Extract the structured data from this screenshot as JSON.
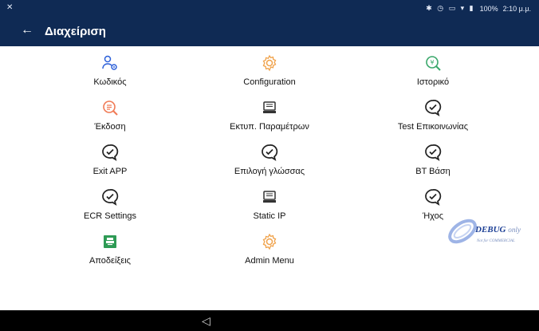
{
  "status_bar": {
    "left_icon": "notification-icon",
    "battery": "100%",
    "time": "2:10 μ.μ.",
    "icons": [
      "bluetooth-icon",
      "alarm-icon",
      "cast-icon",
      "wifi-icon",
      "signal-icon",
      "battery-icon"
    ]
  },
  "app_bar": {
    "title": "Διαχείριση"
  },
  "menu": [
    {
      "label": "Κωδικός",
      "icon": "user-settings-icon",
      "color": "#2b5fd9"
    },
    {
      "label": "Configuration",
      "icon": "gear-icon",
      "color": "#f0a24a"
    },
    {
      "label": "Ιστορικό",
      "icon": "coin-search-icon",
      "color": "#3aa86b"
    },
    {
      "label": "Έκδοση",
      "icon": "list-search-icon",
      "color": "#f07a55"
    },
    {
      "label": "Εκτυπ. Παραμέτρων",
      "icon": "printer-icon",
      "color": "#333333"
    },
    {
      "label": "Test Επικοινωνίας",
      "icon": "message-icon",
      "color": "#222222"
    },
    {
      "label": "Exit APP",
      "icon": "message-icon",
      "color": "#222222"
    },
    {
      "label": "Επιλογή γλώσσας",
      "icon": "message-icon",
      "color": "#222222"
    },
    {
      "label": "BT Βάση",
      "icon": "message-icon",
      "color": "#222222"
    },
    {
      "label": "ECR Settings",
      "icon": "message-icon",
      "color": "#222222"
    },
    {
      "label": "Static IP",
      "icon": "printer-icon",
      "color": "#333333"
    },
    {
      "label": "Ήχος",
      "icon": "message-icon",
      "color": "#222222"
    },
    {
      "label": "Αποδείξεις",
      "icon": "receipt-printer-icon",
      "color": "#2e9b55"
    },
    {
      "label": "Admin Menu",
      "icon": "gear-icon",
      "color": "#f0a24a"
    }
  ],
  "watermark": {
    "main": "DEBUG",
    "suffix": "only",
    "sub": "Not for COMMERCIAL"
  }
}
